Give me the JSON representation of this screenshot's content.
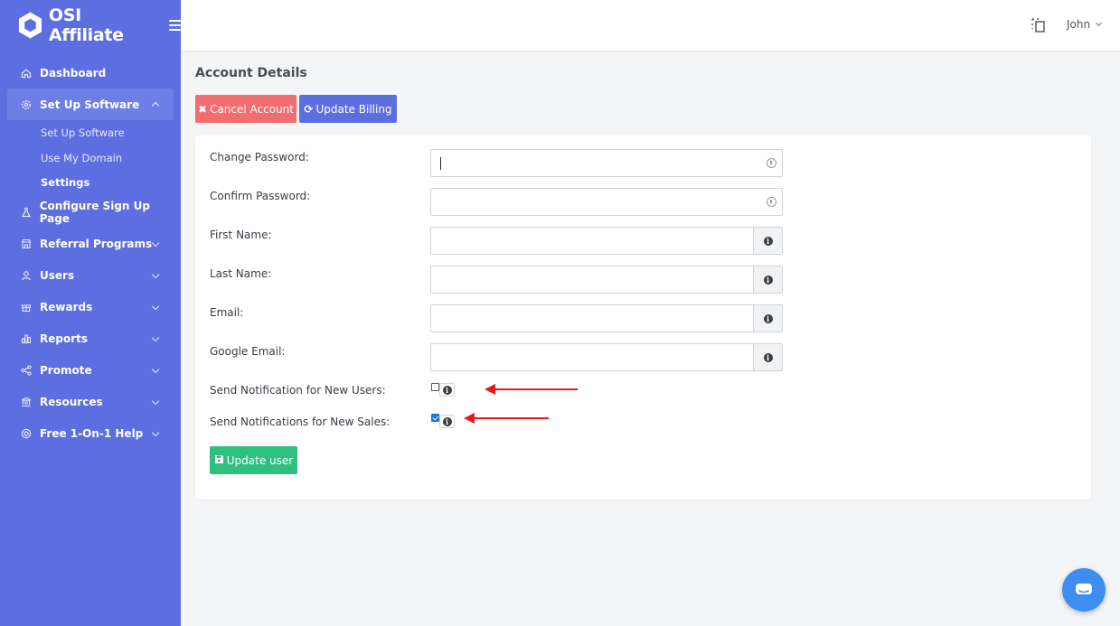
{
  "brand": {
    "name": "OSI Affiliate"
  },
  "topbar": {
    "user": "John"
  },
  "sidebar": {
    "items": [
      {
        "label": "Dashboard",
        "icon": "home-icon"
      },
      {
        "label": "Set Up Software",
        "icon": "gear-icon",
        "expanded": true,
        "children": [
          "Set Up Software",
          "Use My Domain",
          "Settings"
        ]
      },
      {
        "label": "Configure Sign Up Page",
        "icon": "flask-icon"
      },
      {
        "label": "Referral Programs",
        "icon": "store-icon"
      },
      {
        "label": "Users",
        "icon": "user-icon"
      },
      {
        "label": "Rewards",
        "icon": "gift-icon"
      },
      {
        "label": "Reports",
        "icon": "bar-chart-icon"
      },
      {
        "label": "Promote",
        "icon": "share-icon"
      },
      {
        "label": "Resources",
        "icon": "bank-icon"
      },
      {
        "label": "Free 1-On-1 Help",
        "icon": "lifebuoy-icon"
      }
    ]
  },
  "main": {
    "title": "Account Details",
    "cancel_label": "Cancel Account",
    "billing_label": "Update Billing",
    "fields": [
      {
        "label": "Change Password:",
        "value": ""
      },
      {
        "label": "Confirm Password:",
        "value": ""
      },
      {
        "label": "First Name:",
        "value": ""
      },
      {
        "label": "Last Name:",
        "value": ""
      },
      {
        "label": "Email:",
        "value": ""
      },
      {
        "label": "Google Email:",
        "value": ""
      }
    ],
    "notify_users_label": "Send Notification for New Users:",
    "notify_users_checked": false,
    "notify_sales_label": "Send Notifications for New Sales:",
    "notify_sales_checked": true,
    "update_label": "Update user"
  },
  "colors": {
    "sidebar": "#5d6fe0",
    "danger": "#f26d6d",
    "primary": "#5d6fe0",
    "success": "#2ec07f",
    "annotation_arrow": "#e31b1b",
    "chat": "#3d8ef0"
  }
}
